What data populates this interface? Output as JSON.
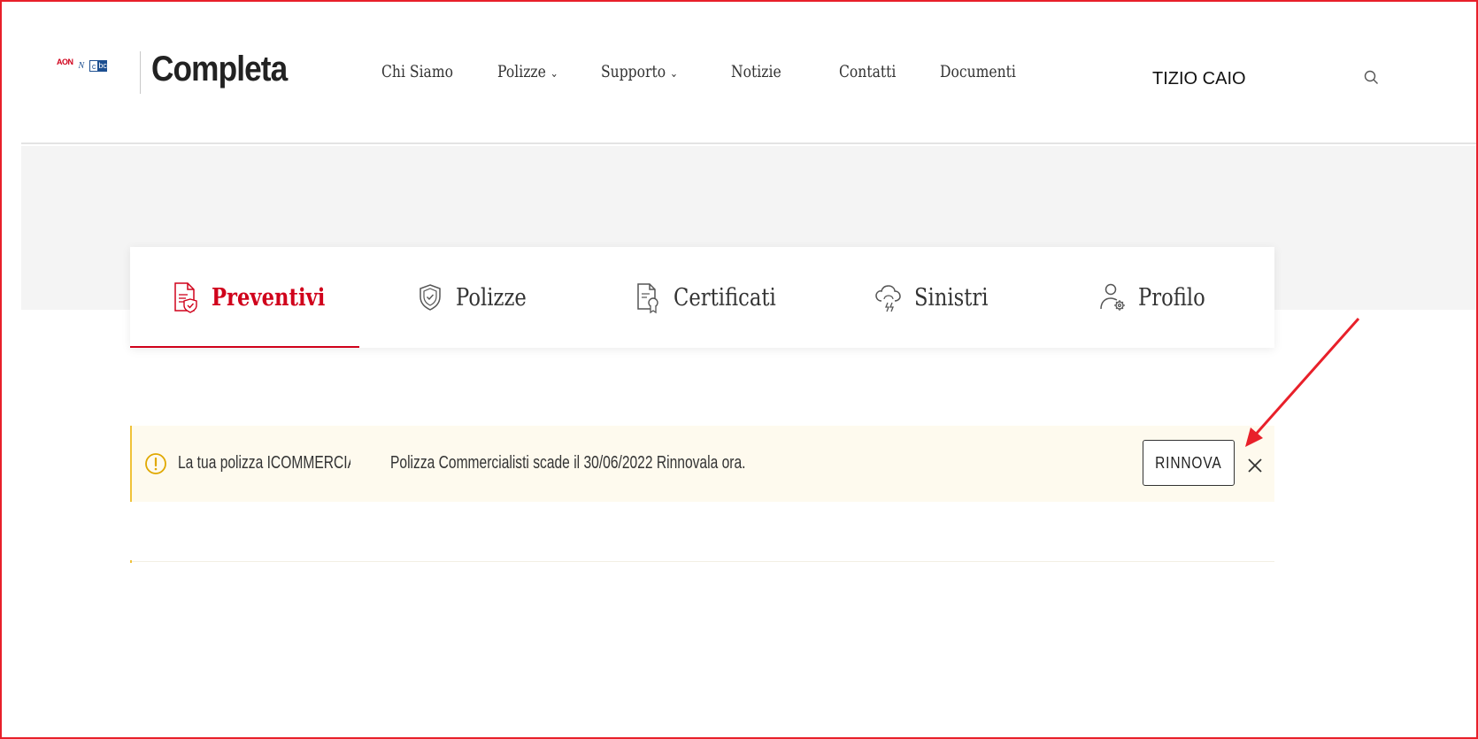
{
  "header": {
    "brand": "Completa",
    "logo_aon": "AON",
    "logo_n": "N",
    "logo_box": [
      "c",
      "bc"
    ],
    "nav": [
      {
        "label": "Chi Siamo",
        "dropdown": false
      },
      {
        "label": "Polizze",
        "dropdown": true
      },
      {
        "label": "Supporto",
        "dropdown": true
      },
      {
        "label": "Notizie",
        "dropdown": false
      },
      {
        "label": "Contatti",
        "dropdown": false
      },
      {
        "label": "Documenti",
        "dropdown": false
      }
    ],
    "user_name": "TIZIO CAIO",
    "search_icon": "search-icon"
  },
  "tabs": [
    {
      "label": "Preventivi",
      "icon": "quote-document-icon",
      "active": true
    },
    {
      "label": "Polizze",
      "icon": "shield-check-icon",
      "active": false
    },
    {
      "label": "Certificati",
      "icon": "certificate-icon",
      "active": false
    },
    {
      "label": "Sinistri",
      "icon": "storm-cloud-icon",
      "active": false
    },
    {
      "label": "Profilo",
      "icon": "user-settings-icon",
      "active": false
    }
  ],
  "alert": {
    "text_part1": "La tua polizza ICOMMERCIALISTI",
    "text_part2": "Polizza Commercialisti scade il 30/06/2022 Rinnovala ora.",
    "button_label": "RINNOVA",
    "close_icon": "close-icon",
    "warning_icon": "warning-icon"
  },
  "colors": {
    "accent": "#d0021b",
    "alert_bg": "#fefaee",
    "alert_border": "#f0c23a",
    "annotation_arrow": "#e8202a"
  }
}
